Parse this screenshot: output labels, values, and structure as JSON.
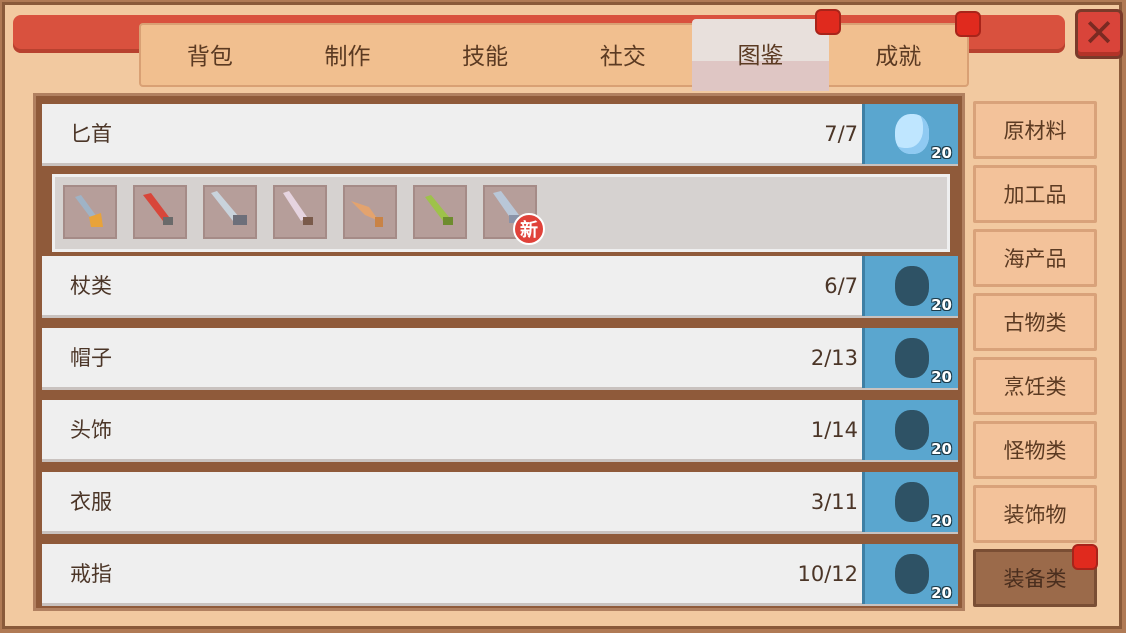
{
  "close_button": {
    "glyph": "✕"
  },
  "tabs": [
    {
      "label": "背包",
      "active": false,
      "badge": false
    },
    {
      "label": "制作",
      "active": false,
      "badge": false
    },
    {
      "label": "技能",
      "active": false,
      "badge": false
    },
    {
      "label": "社交",
      "active": false,
      "badge": false
    },
    {
      "label": "图鉴",
      "active": true,
      "badge": true
    },
    {
      "label": "成就",
      "active": false,
      "badge": true
    }
  ],
  "rows": [
    {
      "name": "匕首",
      "count": "7/7",
      "reward_qty": "20",
      "reward_unlocked": true
    },
    {
      "name": "杖类",
      "count": "6/7",
      "reward_qty": "20",
      "reward_unlocked": false
    },
    {
      "name": "帽子",
      "count": "2/13",
      "reward_qty": "20",
      "reward_unlocked": false
    },
    {
      "name": "头饰",
      "count": "1/14",
      "reward_qty": "20",
      "reward_unlocked": false
    },
    {
      "name": "衣服",
      "count": "3/11",
      "reward_qty": "20",
      "reward_unlocked": false
    },
    {
      "name": "戒指",
      "count": "10/12",
      "reward_qty": "20",
      "reward_unlocked": false
    }
  ],
  "dagger_items": [
    {
      "icon": "golden-hilt-dagger-icon",
      "blade": "#9fb3c6",
      "hilt": "#e8a33a"
    },
    {
      "icon": "red-dagger-icon",
      "blade": "#d8463a",
      "hilt": "#6a6a6a"
    },
    {
      "icon": "steel-sword-icon",
      "blade": "#c9d3dc",
      "hilt": "#6d6f7a"
    },
    {
      "icon": "pink-dagger-icon",
      "blade": "#e6d4e0",
      "hilt": "#7a5a4a"
    },
    {
      "icon": "bone-dagger-icon",
      "blade": "#e3a36e",
      "hilt": "#c98346"
    },
    {
      "icon": "leaf-dagger-icon",
      "blade": "#9ec24a",
      "hilt": "#6e8c2e"
    },
    {
      "icon": "crystal-dagger-icon",
      "blade": "#b9c7d8",
      "hilt": "#8a93a8"
    }
  ],
  "new_badge": "新",
  "categories": [
    {
      "label": "原材料",
      "active": false,
      "badge": false
    },
    {
      "label": "加工品",
      "active": false,
      "badge": false
    },
    {
      "label": "海产品",
      "active": false,
      "badge": false
    },
    {
      "label": "古物类",
      "active": false,
      "badge": false
    },
    {
      "label": "烹饪类",
      "active": false,
      "badge": false
    },
    {
      "label": "怪物类",
      "active": false,
      "badge": false
    },
    {
      "label": "装饰物",
      "active": false,
      "badge": false
    },
    {
      "label": "装备类",
      "active": true,
      "badge": true
    }
  ],
  "colors": {
    "accent_red": "#d9513e",
    "reward_blue": "#5aa6cf",
    "panel_brown": "#8f5a3a"
  }
}
